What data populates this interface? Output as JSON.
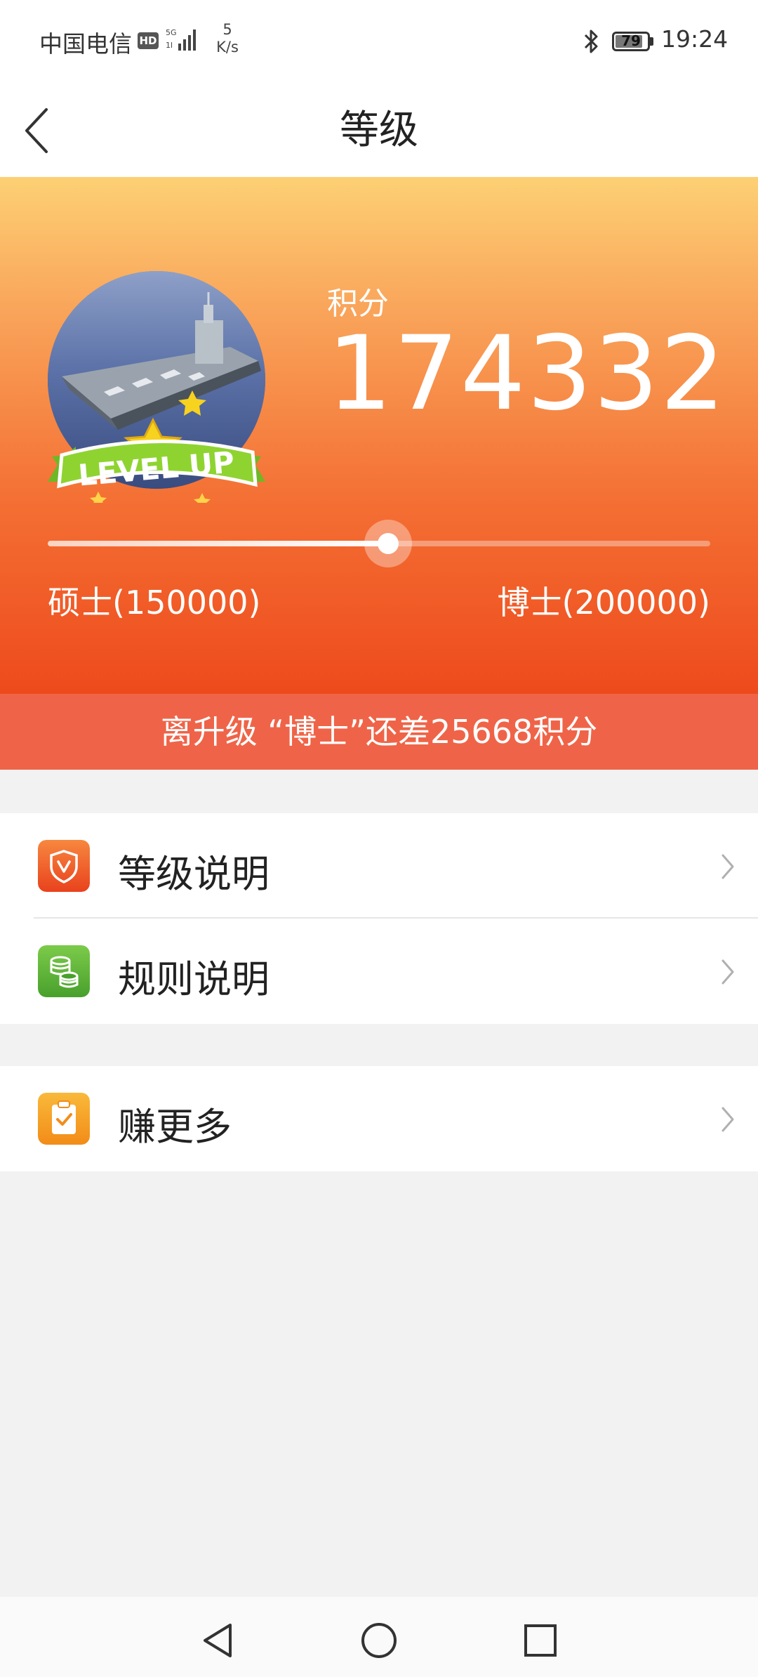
{
  "status_bar": {
    "carrier": "中国电信",
    "hd": "HD",
    "net_speed_value": "5",
    "net_speed_unit": "K/s",
    "battery": "79",
    "time": "19:24"
  },
  "nav": {
    "title": "等级",
    "back_icon": "chevron-left-icon"
  },
  "hero": {
    "avatar_badge_text": "LEVEL UP",
    "score_label": "积分",
    "score_value": "174332",
    "progress_fraction": 0.5134,
    "current_level_label": "硕士(150000)",
    "next_level_label": "博士(200000)",
    "colors": {
      "gradient_top": "#fdd074",
      "gradient_bottom": "#ee4a1c",
      "banner": "#ef6448"
    }
  },
  "gap_banner": "离升级 “博士”还差25668积分",
  "menu": {
    "items": [
      {
        "label": "等级说明",
        "icon": "shield-v-icon",
        "icon_color": "#ef5a2c"
      },
      {
        "label": "规则说明",
        "icon": "coins-icon",
        "icon_color": "#5fb33a"
      },
      {
        "label": "赚更多",
        "icon": "clipboard-check-icon",
        "icon_color": "#f5a020"
      }
    ]
  },
  "system_nav": [
    "back-triangle-icon",
    "home-circle-icon",
    "recents-square-icon"
  ]
}
